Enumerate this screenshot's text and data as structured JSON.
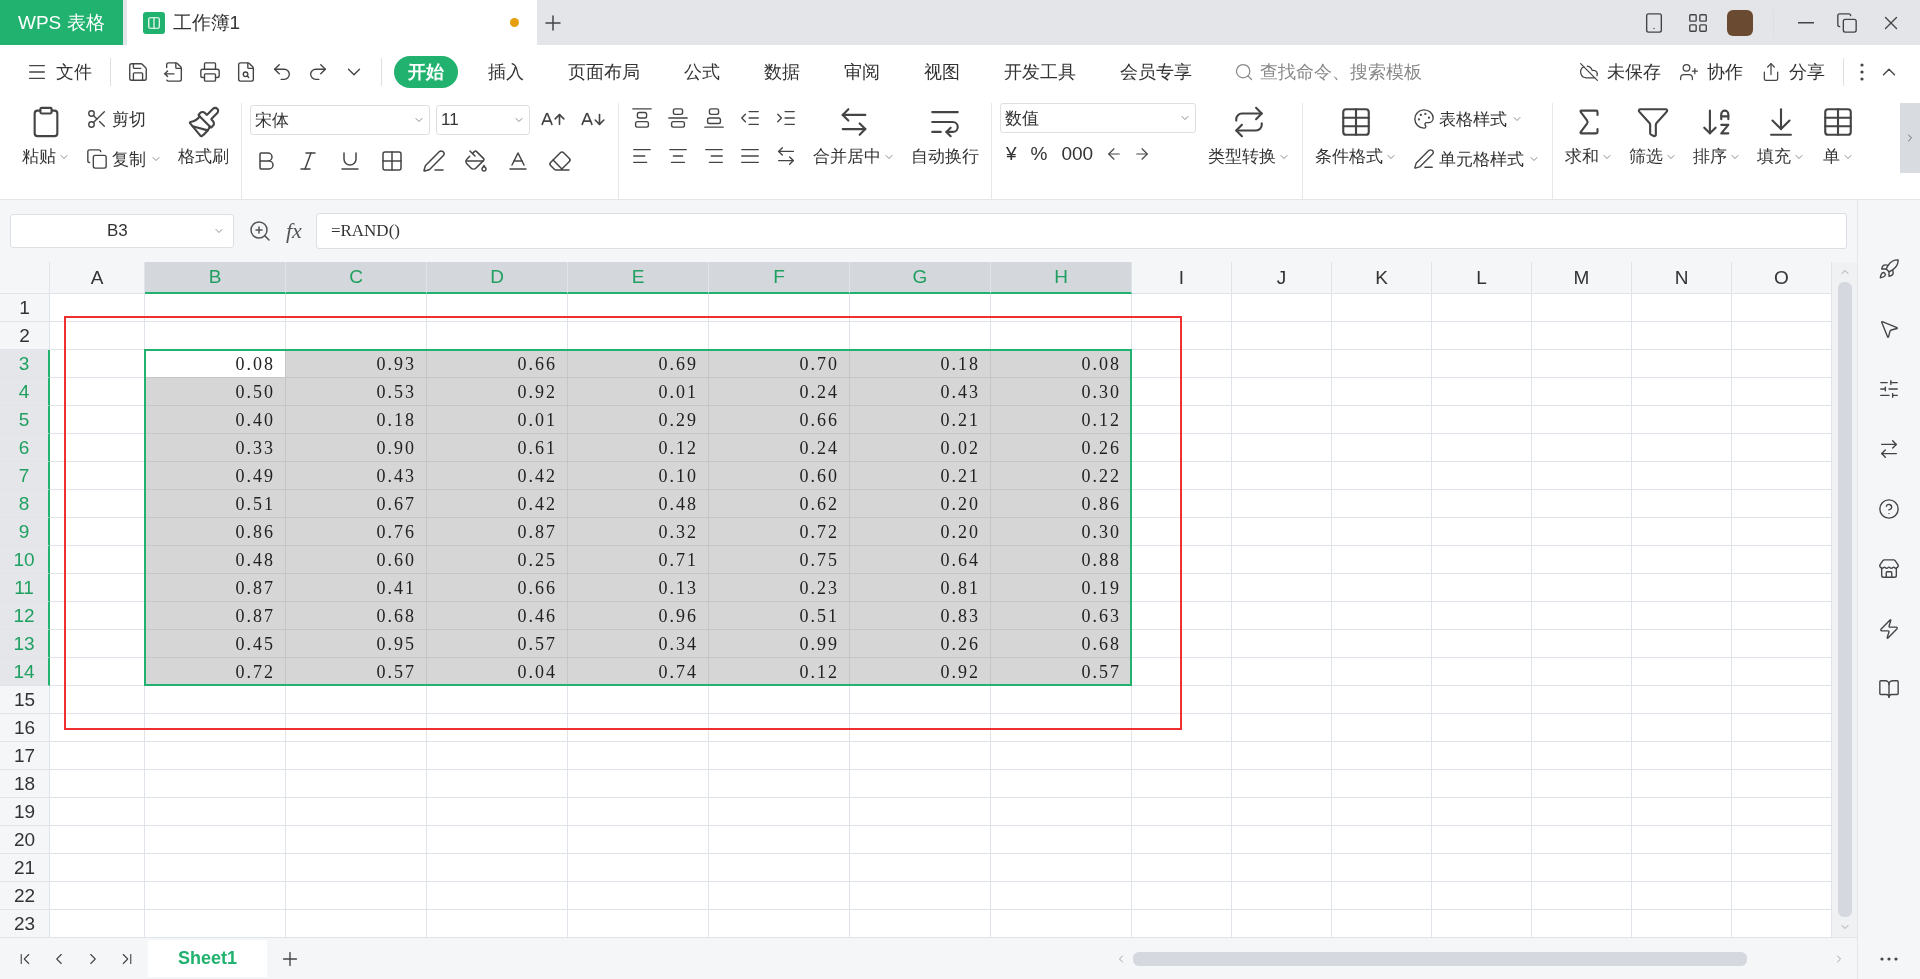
{
  "title_bar": {
    "app_tab": "WPS 表格",
    "doc_tab": {
      "title": "工作簿1",
      "unsaved": true
    }
  },
  "menu": {
    "file": "文件",
    "tabs": [
      {
        "label": "开始",
        "selected": true
      },
      {
        "label": "插入",
        "selected": false
      },
      {
        "label": "页面布局",
        "selected": false
      },
      {
        "label": "公式",
        "selected": false
      },
      {
        "label": "数据",
        "selected": false
      },
      {
        "label": "审阅",
        "selected": false
      },
      {
        "label": "视图",
        "selected": false
      },
      {
        "label": "开发工具",
        "selected": false
      },
      {
        "label": "会员专享",
        "selected": false
      }
    ],
    "search": {
      "placeholder": "查找命令、搜索模板"
    },
    "actions": [
      "未保存",
      "协作",
      "分享"
    ]
  },
  "ribbon": {
    "clipboard": {
      "paste": "粘贴",
      "cut": "剪切",
      "copy": "复制",
      "format_painter": "格式刷"
    },
    "font": {
      "name": "宋体",
      "size": "11"
    },
    "alignment": {
      "merge": "合并居中",
      "wrap": "自动换行"
    },
    "number": {
      "format": "数值",
      "symbols": [
        "¥",
        "%",
        "000"
      ],
      "convert": "类型转换"
    },
    "styles": {
      "conditional": "条件格式",
      "table_style": "表格样式",
      "cell_style": "单元格样式"
    },
    "editing": [
      "求和",
      "筛选",
      "排序",
      "填充",
      "单"
    ]
  },
  "formula_bar": {
    "name_box": "B3",
    "fx": "fx",
    "formula": "=RAND()"
  },
  "sheet": {
    "columns": [
      {
        "label": "A",
        "selected": false
      },
      {
        "label": "B",
        "selected": true
      },
      {
        "label": "C",
        "selected": true
      },
      {
        "label": "D",
        "selected": true
      },
      {
        "label": "E",
        "selected": true
      },
      {
        "label": "F",
        "selected": true
      },
      {
        "label": "G",
        "selected": true
      },
      {
        "label": "H",
        "selected": true
      },
      {
        "label": "I",
        "selected": false
      },
      {
        "label": "J",
        "selected": false
      },
      {
        "label": "K",
        "selected": false
      },
      {
        "label": "L",
        "selected": false
      },
      {
        "label": "M",
        "selected": false
      },
      {
        "label": "N",
        "selected": false
      },
      {
        "label": "O",
        "selected": false
      }
    ],
    "rows": [
      {
        "label": "1",
        "selected": false
      },
      {
        "label": "2",
        "selected": false
      },
      {
        "label": "3",
        "selected": true,
        "cells": [
          {
            "value": "0.08",
            "active": true
          },
          {
            "value": "0.93",
            "active": false
          },
          {
            "value": "0.66",
            "active": false
          },
          {
            "value": "0.69",
            "active": false
          },
          {
            "value": "0.70",
            "active": false
          },
          {
            "value": "0.18",
            "active": false
          },
          {
            "value": "0.08",
            "active": false
          }
        ]
      },
      {
        "label": "4",
        "selected": true,
        "cells": [
          {
            "value": "0.50",
            "active": false
          },
          {
            "value": "0.53",
            "active": false
          },
          {
            "value": "0.92",
            "active": false
          },
          {
            "value": "0.01",
            "active": false
          },
          {
            "value": "0.24",
            "active": false
          },
          {
            "value": "0.43",
            "active": false
          },
          {
            "value": "0.30",
            "active": false
          }
        ]
      },
      {
        "label": "5",
        "selected": true,
        "cells": [
          {
            "value": "0.40",
            "active": false
          },
          {
            "value": "0.18",
            "active": false
          },
          {
            "value": "0.01",
            "active": false
          },
          {
            "value": "0.29",
            "active": false
          },
          {
            "value": "0.66",
            "active": false
          },
          {
            "value": "0.21",
            "active": false
          },
          {
            "value": "0.12",
            "active": false
          }
        ]
      },
      {
        "label": "6",
        "selected": true,
        "cells": [
          {
            "value": "0.33",
            "active": false
          },
          {
            "value": "0.90",
            "active": false
          },
          {
            "value": "0.61",
            "active": false
          },
          {
            "value": "0.12",
            "active": false
          },
          {
            "value": "0.24",
            "active": false
          },
          {
            "value": "0.02",
            "active": false
          },
          {
            "value": "0.26",
            "active": false
          }
        ]
      },
      {
        "label": "7",
        "selected": true,
        "cells": [
          {
            "value": "0.49",
            "active": false
          },
          {
            "value": "0.43",
            "active": false
          },
          {
            "value": "0.42",
            "active": false
          },
          {
            "value": "0.10",
            "active": false
          },
          {
            "value": "0.60",
            "active": false
          },
          {
            "value": "0.21",
            "active": false
          },
          {
            "value": "0.22",
            "active": false
          }
        ]
      },
      {
        "label": "8",
        "selected": true,
        "cells": [
          {
            "value": "0.51",
            "active": false
          },
          {
            "value": "0.67",
            "active": false
          },
          {
            "value": "0.42",
            "active": false
          },
          {
            "value": "0.48",
            "active": false
          },
          {
            "value": "0.62",
            "active": false
          },
          {
            "value": "0.20",
            "active": false
          },
          {
            "value": "0.86",
            "active": false
          }
        ]
      },
      {
        "label": "9",
        "selected": true,
        "cells": [
          {
            "value": "0.86",
            "active": false
          },
          {
            "value": "0.76",
            "active": false
          },
          {
            "value": "0.87",
            "active": false
          },
          {
            "value": "0.32",
            "active": false
          },
          {
            "value": "0.72",
            "active": false
          },
          {
            "value": "0.20",
            "active": false
          },
          {
            "value": "0.30",
            "active": false
          }
        ]
      },
      {
        "label": "10",
        "selected": true,
        "cells": [
          {
            "value": "0.48",
            "active": false
          },
          {
            "value": "0.60",
            "active": false
          },
          {
            "value": "0.25",
            "active": false
          },
          {
            "value": "0.71",
            "active": false
          },
          {
            "value": "0.75",
            "active": false
          },
          {
            "value": "0.64",
            "active": false
          },
          {
            "value": "0.88",
            "active": false
          }
        ]
      },
      {
        "label": "11",
        "selected": true,
        "cells": [
          {
            "value": "0.87",
            "active": false
          },
          {
            "value": "0.41",
            "active": false
          },
          {
            "value": "0.66",
            "active": false
          },
          {
            "value": "0.13",
            "active": false
          },
          {
            "value": "0.23",
            "active": false
          },
          {
            "value": "0.81",
            "active": false
          },
          {
            "value": "0.19",
            "active": false
          }
        ]
      },
      {
        "label": "12",
        "selected": true,
        "cells": [
          {
            "value": "0.87",
            "active": false
          },
          {
            "value": "0.68",
            "active": false
          },
          {
            "value": "0.46",
            "active": false
          },
          {
            "value": "0.96",
            "active": false
          },
          {
            "value": "0.51",
            "active": false
          },
          {
            "value": "0.83",
            "active": false
          },
          {
            "value": "0.63",
            "active": false
          }
        ]
      },
      {
        "label": "13",
        "selected": true,
        "cells": [
          {
            "value": "0.45",
            "active": false
          },
          {
            "value": "0.95",
            "active": false
          },
          {
            "value": "0.57",
            "active": false
          },
          {
            "value": "0.34",
            "active": false
          },
          {
            "value": "0.99",
            "active": false
          },
          {
            "value": "0.26",
            "active": false
          },
          {
            "value": "0.68",
            "active": false
          }
        ]
      },
      {
        "label": "14",
        "selected": true,
        "cells": [
          {
            "value": "0.72",
            "active": false
          },
          {
            "value": "0.57",
            "active": false
          },
          {
            "value": "0.04",
            "active": false
          },
          {
            "value": "0.74",
            "active": false
          },
          {
            "value": "0.12",
            "active": false
          },
          {
            "value": "0.92",
            "active": false
          },
          {
            "value": "0.57",
            "active": false
          }
        ]
      },
      {
        "label": "15",
        "selected": false
      },
      {
        "label": "16",
        "selected": false
      },
      {
        "label": "17",
        "selected": false
      },
      {
        "label": "18",
        "selected": false
      },
      {
        "label": "19",
        "selected": false
      },
      {
        "label": "20",
        "selected": false
      },
      {
        "label": "21",
        "selected": false
      },
      {
        "label": "22",
        "selected": false
      },
      {
        "label": "23",
        "selected": false
      }
    ]
  },
  "sheet_tabs": [
    {
      "label": "Sheet1",
      "selected": true
    }
  ]
}
